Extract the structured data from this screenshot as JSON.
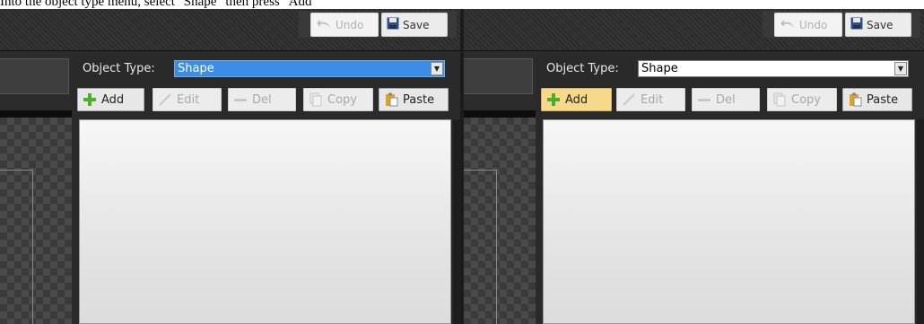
{
  "caption": "Into the object type menu, select \"Shape\" then press \"Add\"",
  "panels": {
    "left": {
      "topbar": {
        "undo_label": "Undo",
        "save_label": "Save"
      },
      "object_type_label": "Object Type:",
      "object_type_value": "Shape",
      "toolbar": {
        "add": "Add",
        "edit": "Edit",
        "del": "Del",
        "copy": "Copy",
        "paste": "Paste"
      }
    },
    "right": {
      "topbar": {
        "undo_label": "Undo",
        "save_label": "Save"
      },
      "object_type_label": "Object Type:",
      "object_type_value": "Shape",
      "toolbar": {
        "add": "Add",
        "edit": "Edit",
        "del": "Del",
        "copy": "Copy",
        "paste": "Paste"
      }
    }
  },
  "colors": {
    "select_highlight": "#3a8ee6",
    "add_highlight": "#f6d98a",
    "add_icon": "#4caf2a",
    "paste_icon": "#e0a020"
  }
}
